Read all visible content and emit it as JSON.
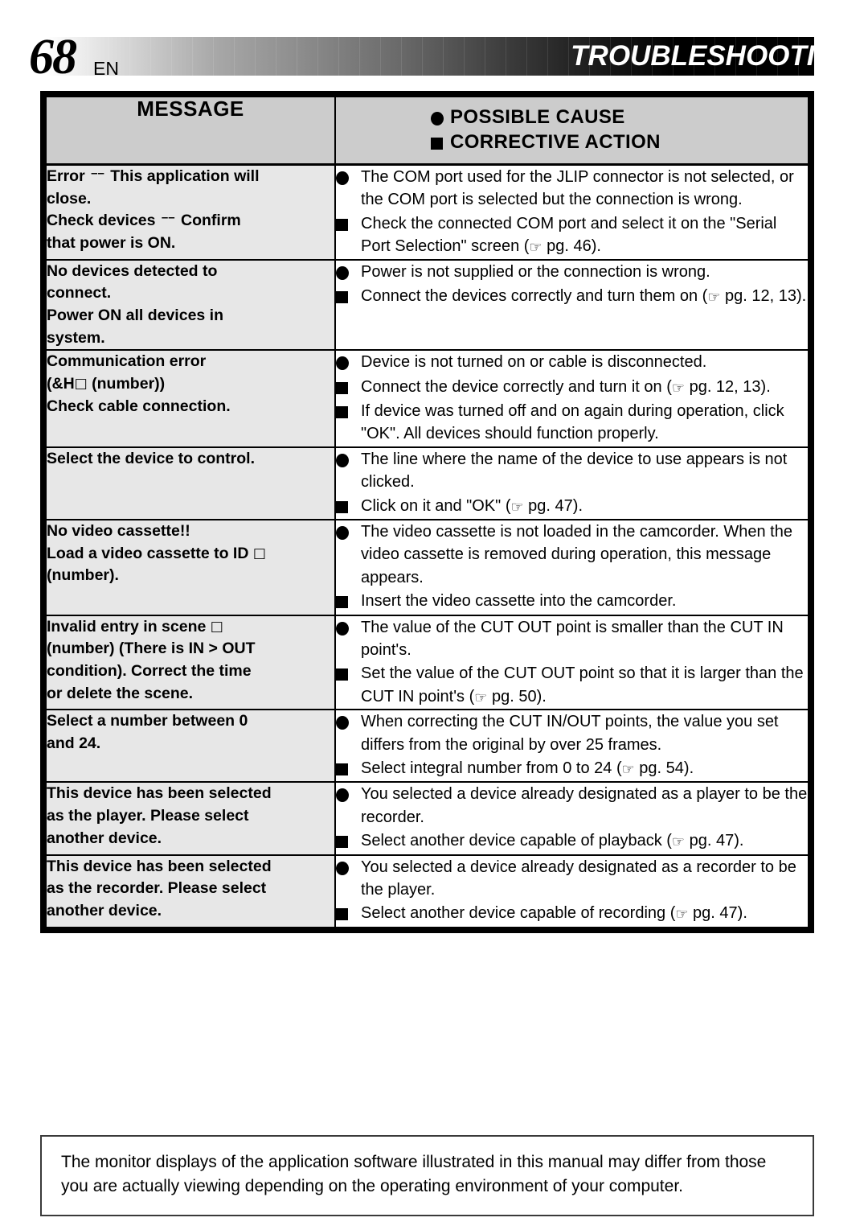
{
  "header": {
    "page_number": "68",
    "language_code": "EN",
    "title": "TROUBLESHOOTING"
  },
  "table": {
    "columns": {
      "message": "MESSAGE",
      "possible_cause": "POSSIBLE CAUSE",
      "corrective_action": "CORRECTIVE ACTION"
    },
    "rows": [
      {
        "message_lines": [
          "Error –– This application will",
          "close.",
          "Check devices –– Confirm",
          "that power is ON."
        ],
        "items": [
          {
            "marker": "dot",
            "text": "The COM port used for the JLIP connector is not selected, or the COM port is selected but the connection is wrong."
          },
          {
            "marker": "square",
            "text": "Check the connected COM port and select it on the \"Serial Port Selection\" screen (☞ pg. 46)."
          }
        ]
      },
      {
        "message_lines": [
          "No devices detected to",
          "connect.",
          "Power ON all devices in",
          "system."
        ],
        "items": [
          {
            "marker": "dot",
            "text": "Power is not supplied or the connection is wrong."
          },
          {
            "marker": "square",
            "text": "Connect the devices correctly and turn them on (☞ pg. 12, 13)."
          }
        ]
      },
      {
        "message_lines": [
          "Communication error",
          "(&H□ (number))",
          "Check cable connection."
        ],
        "items": [
          {
            "marker": "dot",
            "text": "Device is not turned on or cable is disconnected."
          },
          {
            "marker": "square",
            "text": "Connect the device correctly and turn it on (☞ pg. 12, 13)."
          },
          {
            "marker": "square",
            "text": "If device was turned off and on again during operation, click \"OK\". All devices should function properly."
          }
        ]
      },
      {
        "message_lines": [
          "Select the device to control."
        ],
        "items": [
          {
            "marker": "dot",
            "text": "The line where the name of the device to use appears is not clicked."
          },
          {
            "marker": "square",
            "text": "Click on it and \"OK\" (☞ pg. 47)."
          }
        ]
      },
      {
        "message_lines": [
          "No video cassette!!",
          "Load a video cassette to ID □",
          "(number)."
        ],
        "items": [
          {
            "marker": "dot",
            "text": "The video cassette is not loaded in the camcorder. When the video cassette is removed during operation, this message appears."
          },
          {
            "marker": "square",
            "text": "Insert the video cassette into the camcorder."
          }
        ]
      },
      {
        "message_lines": [
          "Invalid entry in scene □",
          "(number) (There is IN > OUT",
          "condition). Correct the time",
          "or delete the scene."
        ],
        "items": [
          {
            "marker": "dot",
            "text": "The value of the CUT OUT point is smaller than the CUT IN point's."
          },
          {
            "marker": "square",
            "text": "Set the value of the CUT OUT point so that it is larger than the CUT IN point's (☞ pg. 50)."
          }
        ]
      },
      {
        "message_lines": [
          "Select a number between 0",
          "and 24."
        ],
        "items": [
          {
            "marker": "dot",
            "text": "When correcting the CUT IN/OUT points, the value you set differs from the original by over 25 frames."
          },
          {
            "marker": "square",
            "text": "Select integral number from 0 to 24 (☞ pg. 54)."
          }
        ]
      },
      {
        "message_lines": [
          "This device has been selected",
          "as the player. Please select",
          "another device."
        ],
        "items": [
          {
            "marker": "dot",
            "text": "You selected a device already designated as a player to be the recorder."
          },
          {
            "marker": "square",
            "text": "Select another device capable of playback (☞ pg. 47)."
          }
        ]
      },
      {
        "message_lines": [
          "This device has been selected",
          "as the recorder. Please select",
          "another device."
        ],
        "items": [
          {
            "marker": "dot",
            "text": "You selected a device already designated as a recorder to be the player."
          },
          {
            "marker": "square",
            "text": "Select another device capable of recording (☞ pg. 47)."
          }
        ]
      }
    ]
  },
  "note": {
    "text": "The monitor displays of the application software illustrated in this manual may differ from those you are actually viewing depending on the operating environment of your computer."
  }
}
